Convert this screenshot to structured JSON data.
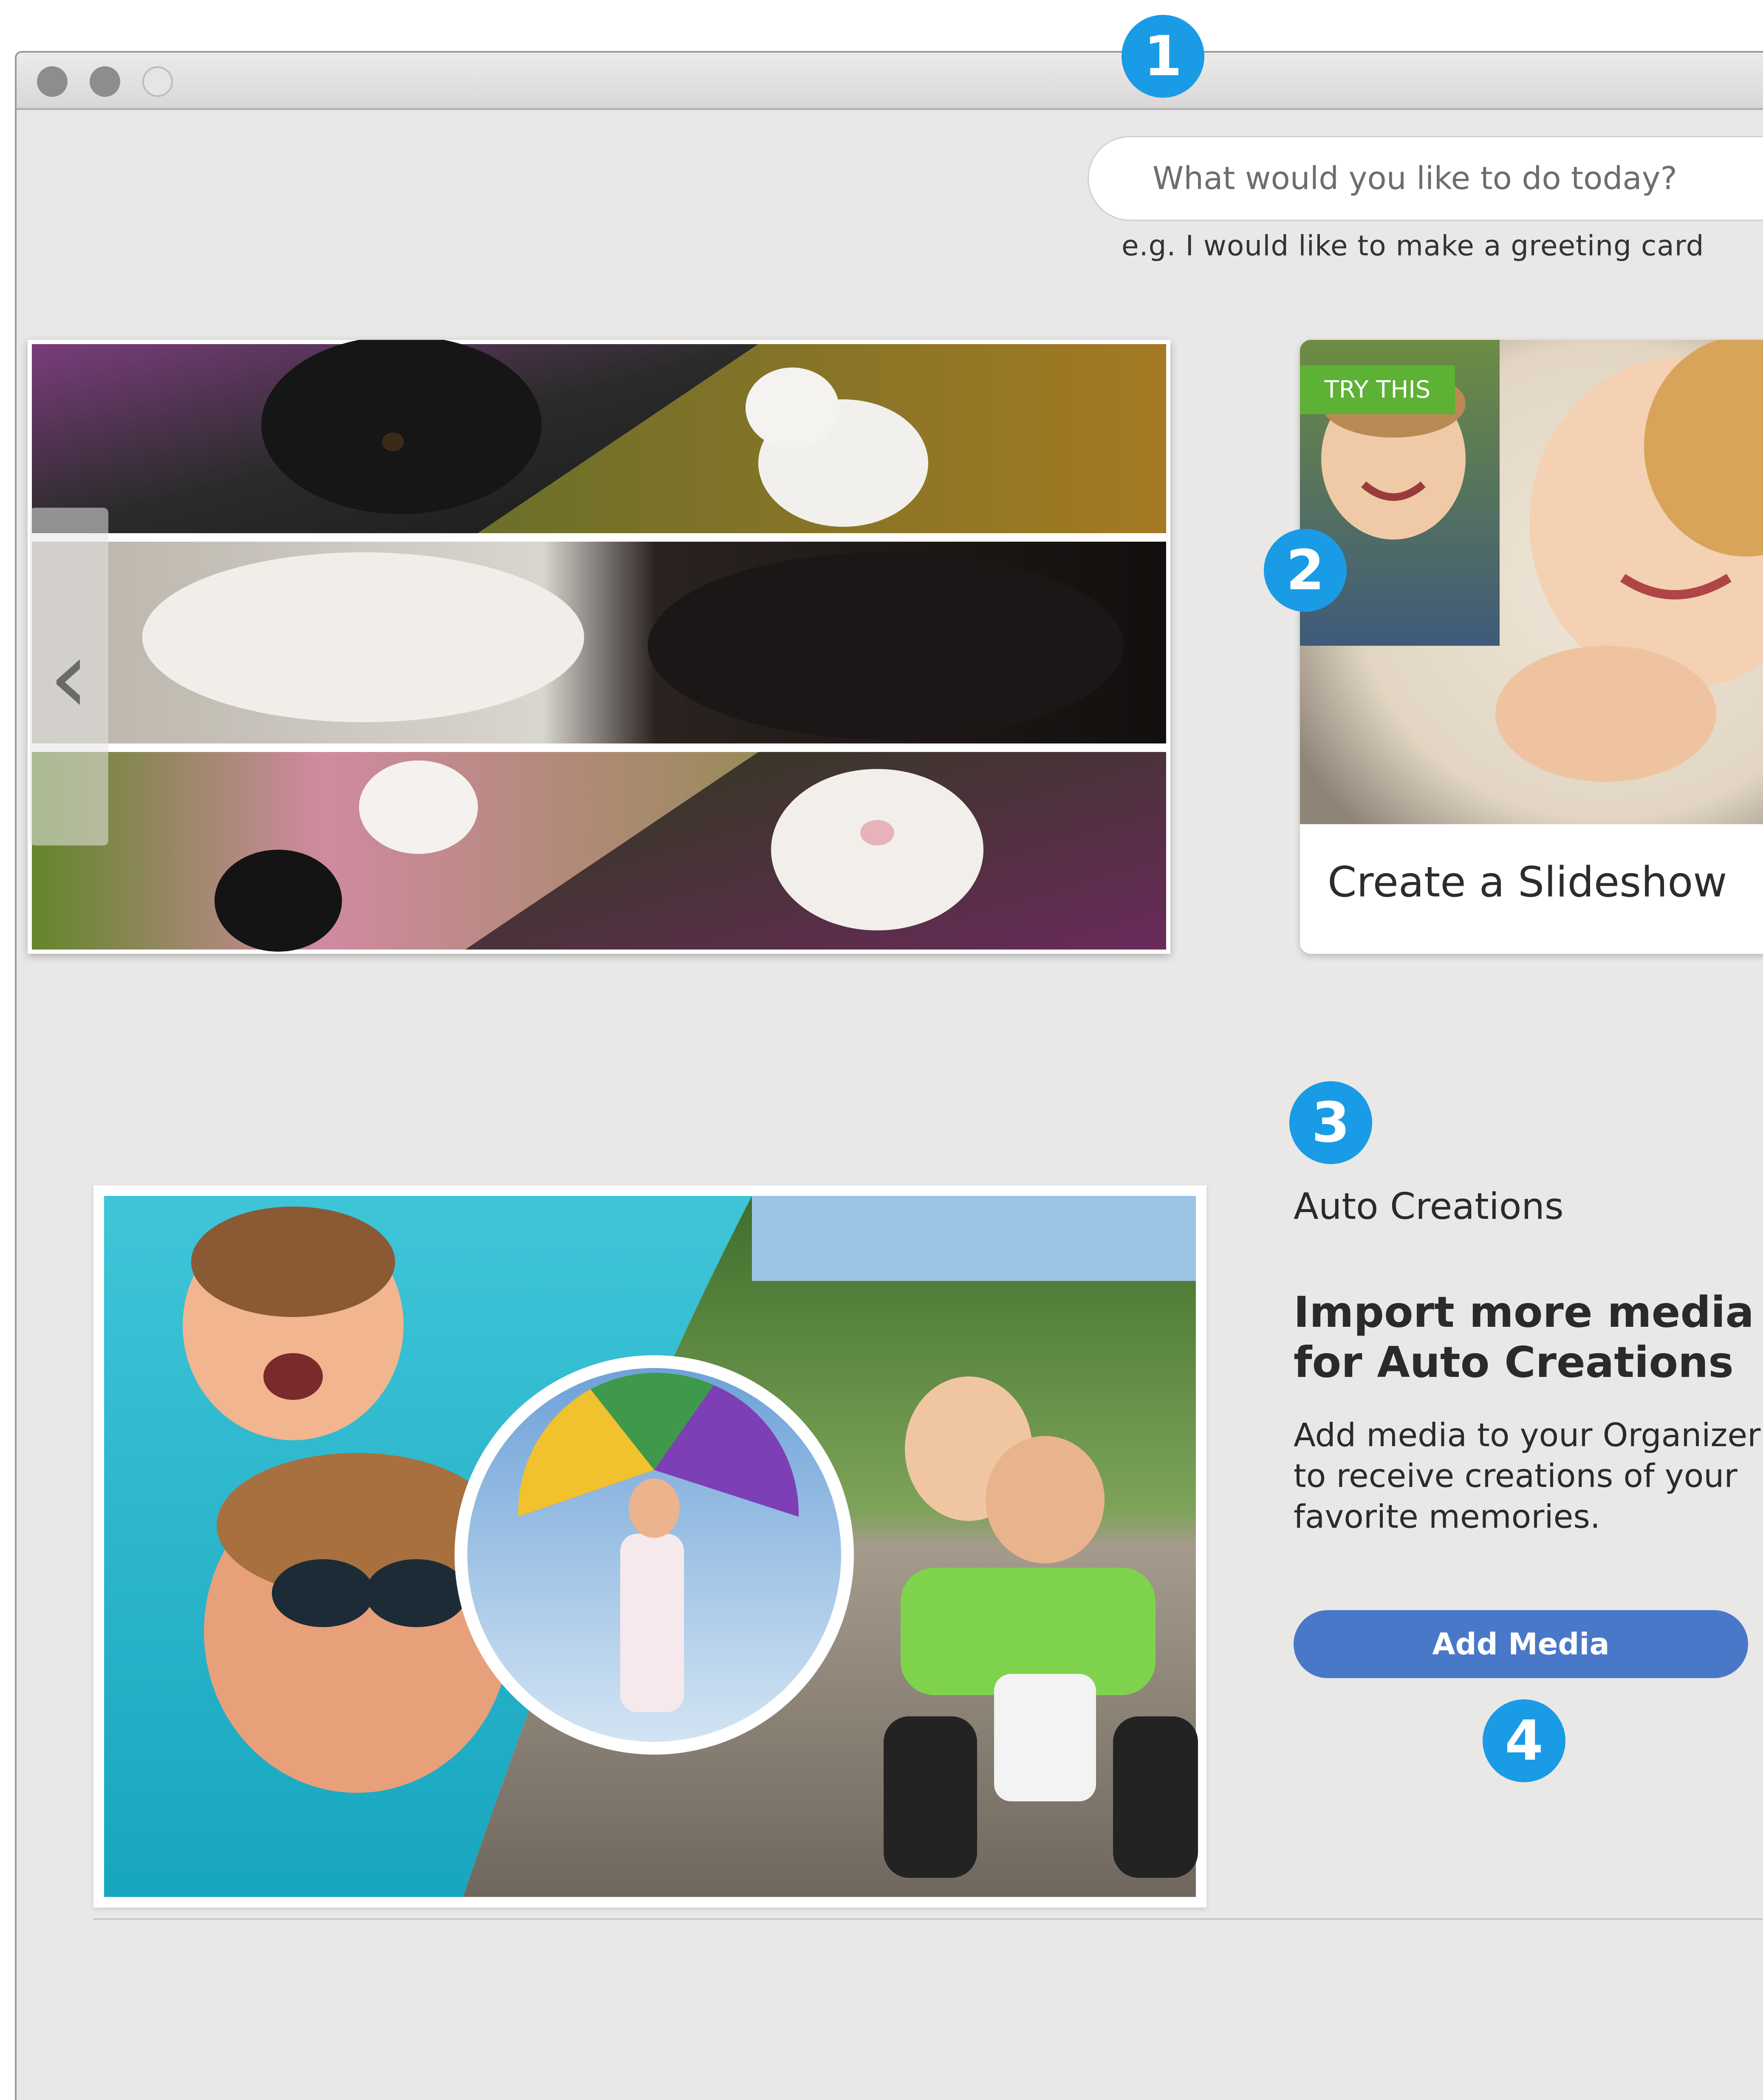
{
  "callouts": [
    "1",
    "2",
    "3",
    "4"
  ],
  "search": {
    "placeholder": "What would you like to do today?",
    "hint": "e.g. I would like to make a greeting card"
  },
  "carousel": {
    "prev_arrow": "‹"
  },
  "try_this_card": {
    "badge": "TRY THIS",
    "title": "Create a Slideshow"
  },
  "auto_creations": {
    "heading": "Auto Creations",
    "title": "Import more media for Auto Creations",
    "description": "Add media to your Organizer to receive creations of your favorite memories.",
    "button_label": "Add Media"
  },
  "colors": {
    "callout": "#1a9be6",
    "badge": "#5db135",
    "button": "#4a78c8",
    "background": "#e9e8e6"
  }
}
